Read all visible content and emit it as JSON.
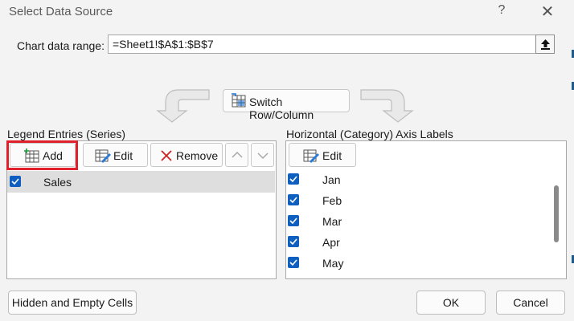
{
  "dialog": {
    "title": "Select Data Source",
    "help_glyph": "?",
    "close_glyph": "✕"
  },
  "range": {
    "label": "Chart data range:",
    "value": "=Sheet1!$A$1:$B$7"
  },
  "switch_button": {
    "label": "Switch Row/Column"
  },
  "legend": {
    "label": "Legend Entries (Series)",
    "add_label": "Add",
    "edit_label": "Edit",
    "remove_label": "Remove",
    "series": [
      {
        "name": "Sales",
        "checked": true
      }
    ]
  },
  "category": {
    "label": "Horizontal (Category) Axis Labels",
    "edit_label": "Edit",
    "items": [
      {
        "label": "Jan",
        "checked": true
      },
      {
        "label": "Feb",
        "checked": true
      },
      {
        "label": "Mar",
        "checked": true
      },
      {
        "label": "Apr",
        "checked": true
      },
      {
        "label": "May",
        "checked": true
      }
    ]
  },
  "footer": {
    "hidden_cells_label": "Hidden and Empty Cells",
    "ok_label": "OK",
    "cancel_label": "Cancel"
  },
  "colors": {
    "accent": "#0f5fc0",
    "highlight": "#e0202a"
  }
}
